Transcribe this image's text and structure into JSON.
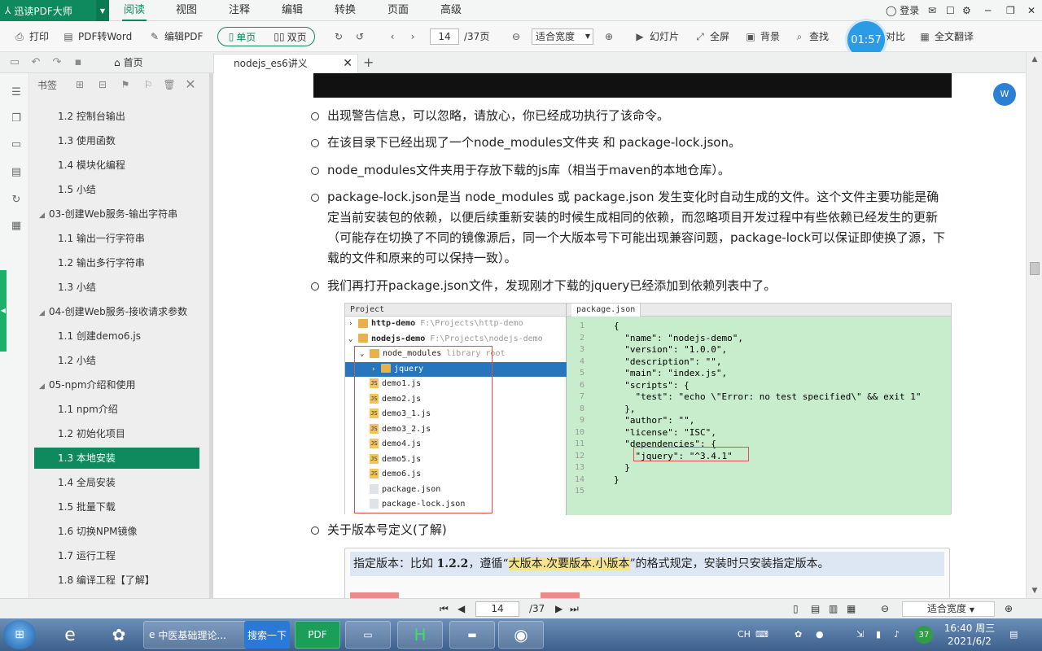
{
  "app": {
    "name": "迅读PDF大师"
  },
  "menu": {
    "items": [
      "阅读",
      "视图",
      "注释",
      "编辑",
      "转换",
      "页面",
      "高级"
    ],
    "active": "阅读",
    "login": "登录"
  },
  "toolbar": {
    "print": "打印",
    "pdf_to_word": "PDF转Word",
    "edit_pdf": "编辑PDF",
    "single_page": "单页",
    "double_page": "双页",
    "current_page": "14",
    "total_pages": "/37页",
    "zoom_mode": "适合宽度",
    "slideshow": "幻灯片",
    "fullscreen": "全屏",
    "background": "背景",
    "find": "查找",
    "compare": "对比",
    "translate": "全文翻译"
  },
  "timer": "01:57",
  "tabs": {
    "home": "首页",
    "doc": "nodejs_es6讲义"
  },
  "sidebar": {
    "title": "书签",
    "items": [
      {
        "label": "1.2 控制台输出",
        "level": 2
      },
      {
        "label": "1.3 使用函数",
        "level": 2
      },
      {
        "label": "1.4 模块化编程",
        "level": 2
      },
      {
        "label": "1.5 小结",
        "level": 2
      },
      {
        "label": "03-创建Web服务-输出字符串",
        "level": 1
      },
      {
        "label": "1.1 输出一行字符串",
        "level": 2
      },
      {
        "label": "1.2 输出多行字符串",
        "level": 2
      },
      {
        "label": "1.3 小结",
        "level": 2
      },
      {
        "label": "04-创建Web服务-接收请求参数",
        "level": 1
      },
      {
        "label": "1.1 创建demo6.js",
        "level": 2
      },
      {
        "label": "1.2 小结",
        "level": 2
      },
      {
        "label": "05-npm介绍和使用",
        "level": 1
      },
      {
        "label": "1.1 npm介绍",
        "level": 2
      },
      {
        "label": "1.2 初始化项目",
        "level": 2
      },
      {
        "label": "1.3 本地安装",
        "level": 2,
        "selected": true
      },
      {
        "label": "1.4 全局安装",
        "level": 2
      },
      {
        "label": "1.5 批量下载",
        "level": 2
      },
      {
        "label": "1.6 切换NPM镜像",
        "level": 2
      },
      {
        "label": "1.7 运行工程",
        "level": 2
      },
      {
        "label": "1.8 编译工程【了解】",
        "level": 2
      }
    ]
  },
  "doc": {
    "bullets": [
      "出现警告信息，可以忽略，请放心，你已经成功执行了该命令。",
      "在该目录下已经出现了一个node_modules文件夹 和 package-lock.json。",
      "node_modules文件夹用于存放下载的js库（相当于maven的本地仓库）。",
      "package-lock.json是当 node_modules 或 package.json 发生变化时自动生成的文件。这个文件主要功能是确定当前安装包的依赖，以便后续重新安装的时候生成相同的依赖，而忽略项目开发过程中有些依赖已经发生的更新（可能存在切换了不同的镜像源后，同一个大版本号下可能出现兼容问题，package-lock可以保证即使换了源，下载的文件和原来的可以保持一致）。",
      "我们再打开package.json文件，发现刚才下载的jquery已经添加到依赖列表中了。",
      "关于版本号定义(了解)"
    ],
    "screenshot": {
      "project_header": "Project",
      "tree": [
        {
          "name": "http-demo",
          "path": "F:\\Projects\\http-demo",
          "kind": "folder",
          "indent": 0,
          "bold": true
        },
        {
          "name": "nodejs-demo",
          "path": "F:\\Projects\\nodejs-demo",
          "kind": "folder",
          "indent": 0,
          "bold": true
        },
        {
          "name": "node_modules",
          "path": "library root",
          "kind": "folder",
          "indent": 1
        },
        {
          "name": "jquery",
          "path": "",
          "kind": "folder",
          "indent": 2,
          "selected": true
        },
        {
          "name": "demo1.js",
          "path": "",
          "kind": "js",
          "indent": 1
        },
        {
          "name": "demo2.js",
          "path": "",
          "kind": "js",
          "indent": 1
        },
        {
          "name": "demo3_1.js",
          "path": "",
          "kind": "js",
          "indent": 1
        },
        {
          "name": "demo3_2.js",
          "path": "",
          "kind": "js",
          "indent": 1
        },
        {
          "name": "demo4.js",
          "path": "",
          "kind": "js",
          "indent": 1
        },
        {
          "name": "demo5.js",
          "path": "",
          "kind": "js",
          "indent": 1
        },
        {
          "name": "demo6.js",
          "path": "",
          "kind": "js",
          "indent": 1
        },
        {
          "name": "package.json",
          "path": "",
          "kind": "json",
          "indent": 1
        },
        {
          "name": "package-lock.json",
          "path": "",
          "kind": "json",
          "indent": 1
        }
      ],
      "editor_tab": "package.json",
      "code_lines": [
        "{",
        "  \"name\": \"nodejs-demo\",",
        "  \"version\": \"1.0.0\",",
        "  \"description\": \"\",",
        "  \"main\": \"index.js\",",
        "  \"scripts\": {",
        "    \"test\": \"echo \\\"Error: no test specified\\\" && exit 1\"",
        "  },",
        "  \"author\": \"\",",
        "  \"license\": \"ISC\",",
        "  \"dependencies\": {",
        "    \"jquery\": \"^3.4.1\"",
        "  }",
        "}",
        ""
      ]
    },
    "note": {
      "prefix": "指定版本：比如 ",
      "version": "1.2.2",
      "mid": "，遵循“",
      "highlight": "大版本.次要版本.小版本",
      "suffix": "”的格式规定，安装时只安装指定版本。"
    }
  },
  "statusbar": {
    "page": "14",
    "total": "/37",
    "zoom": "适合宽度"
  },
  "taskbar": {
    "ie_title": "中医基础理论...",
    "search": "搜索一下",
    "pdf_label": "PDF",
    "h_label": "H",
    "lang": "CH",
    "badge": "37",
    "time": "16:40 周三",
    "date": "2021/6/2"
  }
}
